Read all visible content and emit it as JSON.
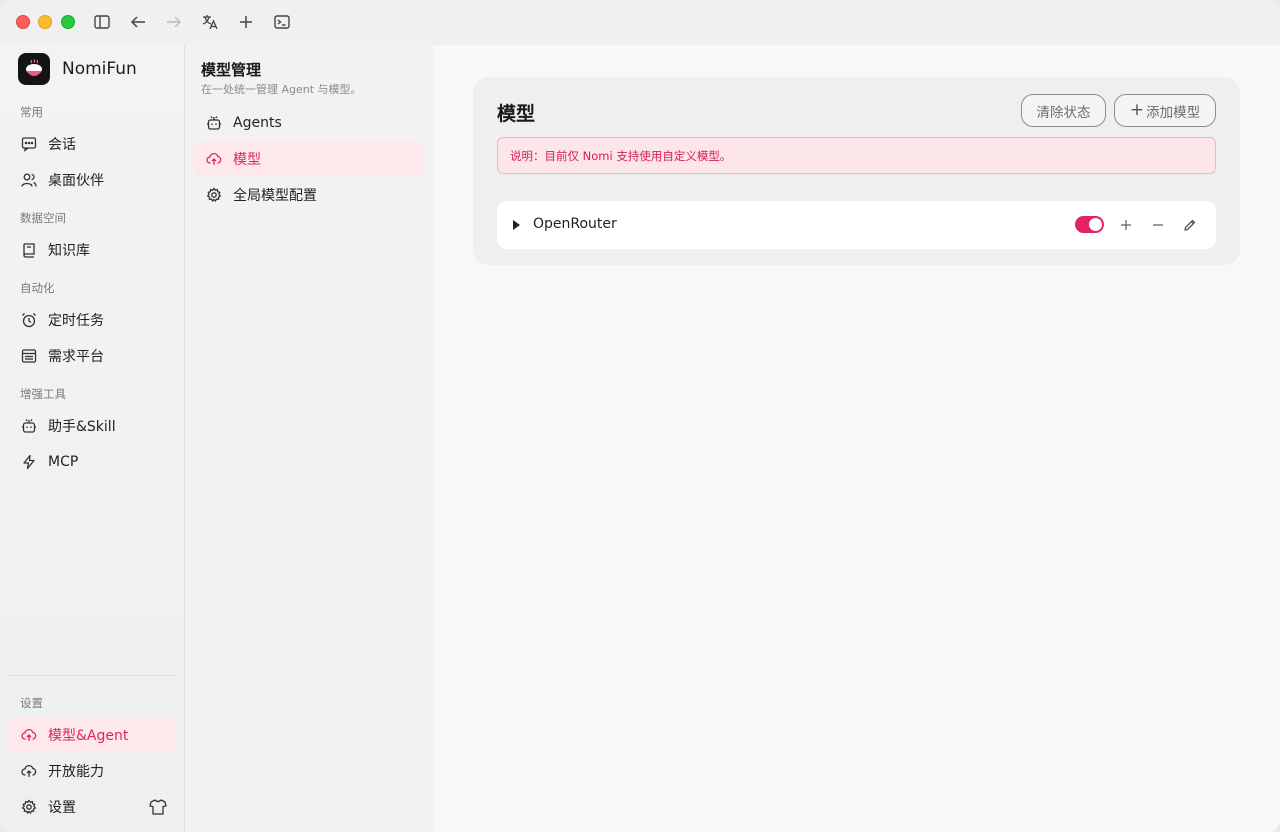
{
  "app": {
    "name": "NomiFun"
  },
  "sidebar": {
    "sections": {
      "common": "常用",
      "data_space": "数据空间",
      "automation": "自动化",
      "tools": "增强工具",
      "settings": "设置"
    },
    "items": {
      "chat": "会话",
      "desktop_pet": "桌面伙伴",
      "knowledge": "知识库",
      "scheduled": "定时任务",
      "requirements": "需求平台",
      "assistant": "助手&Skill",
      "mcp": "MCP",
      "model_agent": "模型&Agent",
      "open_capability": "开放能力",
      "settings": "设置"
    }
  },
  "midpanel": {
    "title": "模型管理",
    "subtitle": "在一处统一管理 Agent 与模型。",
    "items": {
      "agents": "Agents",
      "models": "模型",
      "global_config": "全局模型配置"
    }
  },
  "main": {
    "title": "模型",
    "clear_button": "清除状态",
    "add_button": "添加模型",
    "notice": "说明：目前仅 Nomi 支持使用自定义模型。",
    "providers": [
      {
        "name": "OpenRouter",
        "enabled": true
      }
    ]
  },
  "colors": {
    "accent": "#e0245e",
    "accent_bg": "#fde8ec"
  }
}
